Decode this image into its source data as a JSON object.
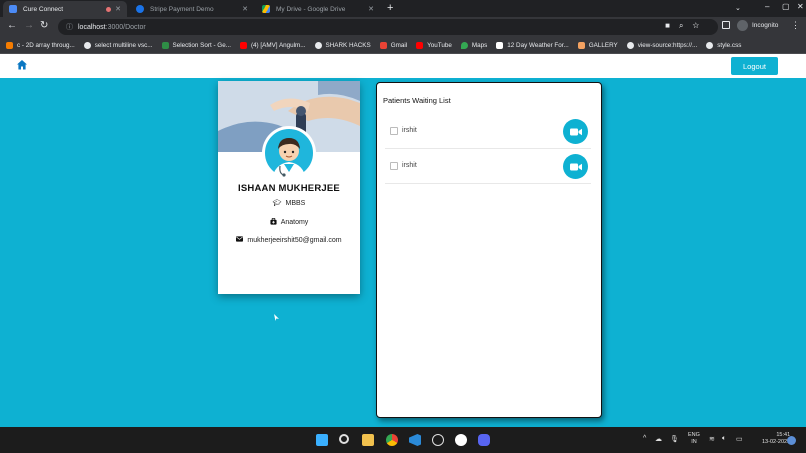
{
  "browser": {
    "tabs": [
      {
        "title": "Cure Connect",
        "active": true
      },
      {
        "title": "Stripe Payment Demo",
        "active": false
      },
      {
        "title": "My Drive - Google Drive",
        "active": false
      }
    ],
    "url_host": "localhost",
    "url_path": ":3000/Doctor",
    "profile_label": "Incognito",
    "bookmarks": [
      {
        "label": "c - 2D array throug..."
      },
      {
        "label": "select multiline vsc..."
      },
      {
        "label": "Selection Sort - Ge..."
      },
      {
        "label": "(4) [AMV] Angulm..."
      },
      {
        "label": "SHARK HACKS"
      },
      {
        "label": "Gmail"
      },
      {
        "label": "YouTube"
      },
      {
        "label": "Maps"
      },
      {
        "label": "12 Day Weather For..."
      },
      {
        "label": "GALLERY"
      },
      {
        "label": "view-source:https://..."
      },
      {
        "label": "style.css"
      }
    ]
  },
  "navbar": {
    "logout_label": "Logout"
  },
  "doctor": {
    "name": "ISHAAN MUKHERJEE",
    "degree": "MBBS",
    "department": "Anatomy",
    "email": "mukherjeeirshit50@gmail.com"
  },
  "waiting_list": {
    "title": "Patients Waiting List",
    "patients": [
      {
        "name": "irshit"
      },
      {
        "name": "irshit"
      }
    ]
  },
  "taskbar": {
    "lang_line1": "ENG",
    "lang_line2": "IN",
    "time": "15:41",
    "date": "13-02-2022"
  },
  "colors": {
    "brand": "#0eb1d2",
    "chrome_dark": "#202124",
    "chrome_toolbar": "#35363a"
  }
}
